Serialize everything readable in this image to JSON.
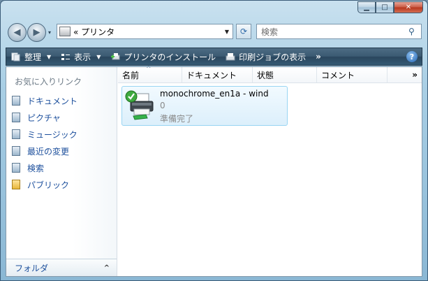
{
  "window": {
    "controls": {
      "minimize": "▁",
      "maximize": "□",
      "close": "✕"
    }
  },
  "nav": {
    "back": "◀",
    "forward": "▶",
    "history": "▾"
  },
  "address": {
    "text": "«  プリンタ"
  },
  "search": {
    "placeholder": "検索"
  },
  "toolbar": {
    "organize": "整理",
    "views": "表示",
    "install_printer": "プリンタのインストール",
    "view_queue": "印刷ジョブの表示",
    "more": "»",
    "help": "?"
  },
  "sidebar": {
    "title": "お気に入りリンク",
    "items": [
      {
        "label": "ドキュメント",
        "icon": "documents-icon"
      },
      {
        "label": "ピクチャ",
        "icon": "pictures-icon"
      },
      {
        "label": "ミュージック",
        "icon": "music-icon"
      },
      {
        "label": "最近の変更",
        "icon": "recent-icon"
      },
      {
        "label": "検索",
        "icon": "search-folder-icon"
      },
      {
        "label": "パブリック",
        "icon": "public-folder-icon"
      }
    ],
    "folders_label": "フォルダ"
  },
  "columns": {
    "name": "名前",
    "documents": "ドキュメント",
    "status": "状態",
    "comment": "コメント",
    "more": "»",
    "sort_indicator": "^"
  },
  "printer": {
    "name": "monochrome_en1a - wind",
    "jobs": "0",
    "status": "準備完了"
  },
  "colors": {
    "toolbar": "#3b5a72",
    "link": "#1c4f9c",
    "selection": "#dceffb"
  }
}
